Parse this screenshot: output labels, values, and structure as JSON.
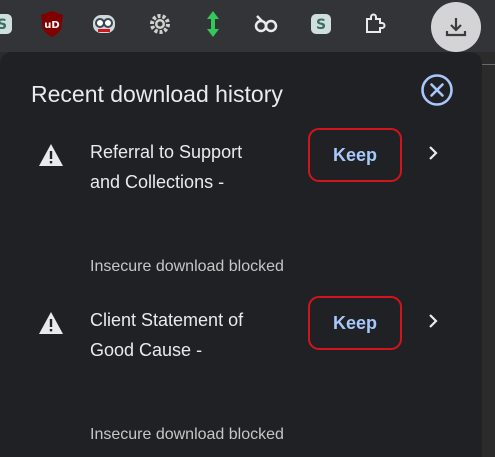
{
  "toolbar": {
    "extensions": [
      {
        "icon": "s-extension-icon"
      },
      {
        "icon": "ublock-origin-icon",
        "label": "uD"
      },
      {
        "icon": "robot-face-icon"
      },
      {
        "icon": "gear-icon"
      },
      {
        "icon": "green-arrows-icon"
      },
      {
        "icon": "glasses-link-icon"
      },
      {
        "icon": "s-extension-icon"
      },
      {
        "icon": "puzzle-piece-icon"
      },
      {
        "icon": "download-icon"
      }
    ]
  },
  "panel": {
    "title": "Recent download history",
    "close_icon": "close-circle-icon",
    "items": [
      {
        "name_line1": "Referral to Support",
        "name_line2": "and Collections -",
        "action_label": "Keep",
        "status": "Insecure download blocked",
        "icon": "warning-icon"
      },
      {
        "name_line1": "Client Statement of",
        "name_line2": "Good Cause -",
        "action_label": "Keep",
        "status": "Insecure download blocked",
        "icon": "warning-icon"
      }
    ]
  },
  "colors": {
    "panel_bg": "#202124",
    "toolbar_bg": "#333437",
    "keep_text": "#a8c7fa",
    "highlight_border": "#d2141c",
    "close_ring": "#a8c7fa"
  }
}
